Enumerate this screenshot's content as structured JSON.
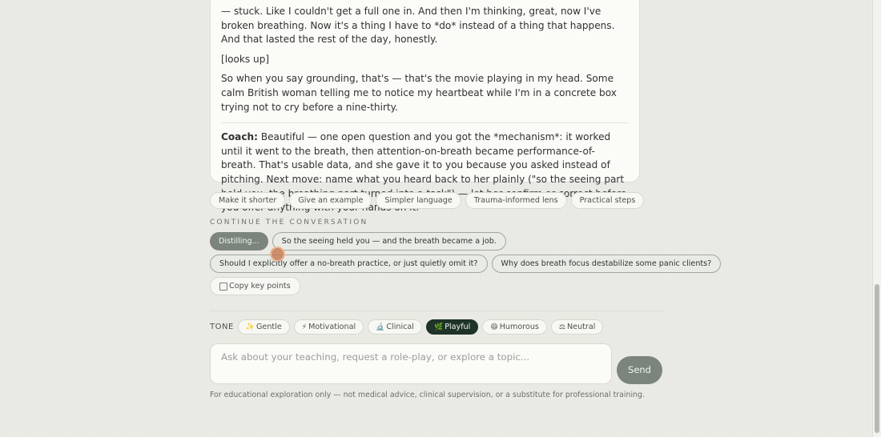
{
  "message": {
    "user_p1": "— stuck. Like I couldn't get a full one in. And then I'm thinking, great, now I've broken breathing. Now it's a thing I have to *do* instead of a thing that happens. And that lasted the rest of the day, honestly.",
    "user_p2": "[looks up]",
    "user_p3": "So when you say grounding, that's — that's the movie playing in my head. Some calm British woman telling me to notice my heartbeat while I'm in a concrete box trying not to cry before a nine-thirty.",
    "coach_label": "Coach:",
    "coach_text": " Beautiful — one open question and you got the *mechanism*: it worked until it went to the breath, then attention-on-breath became performance-of-breath. That's usable data, and she gave it to you because you asked instead of pitching. Next move: name what you heard back to her plainly (\"so the seeing part held you, the breathing part turned into a task\") — let her confirm or correct before you offer anything with your hands on it."
  },
  "refine": [
    "Make it shorter",
    "Give an example",
    "Simpler language",
    "Trauma-informed lens",
    "Practical steps"
  ],
  "continue": {
    "label": "CONTINUE THE CONVERSATION",
    "distilling": "Distilling...",
    "suggestions": [
      "So the seeing held you — and the breath became a job.",
      "Should I explicitly offer a no-breath practice, or just quietly omit it?",
      "Why does breath focus destabilize some panic clients?"
    ],
    "copy_label": "Copy key points"
  },
  "tone": {
    "label": "TONE",
    "options": [
      {
        "icon": "✨",
        "label": "Gentle"
      },
      {
        "icon": "⚡",
        "label": "Motivational"
      },
      {
        "icon": "🔬",
        "label": "Clinical"
      },
      {
        "icon": "🌿",
        "label": "Playful"
      },
      {
        "icon": "😄",
        "label": "Humorous"
      },
      {
        "icon": "⚖",
        "label": "Neutral"
      }
    ],
    "active": "Playful"
  },
  "composer": {
    "placeholder": "Ask about your teaching, request a role-play, or explore a topic...",
    "send_label": "Send"
  },
  "footer": "For educational exploration only — not medical advice, clinical supervision, or a substitute for professional training.",
  "colors": {
    "background": "#ebebe5",
    "accent_dark": "#1f3328",
    "accent_muted": "#7c857d"
  }
}
